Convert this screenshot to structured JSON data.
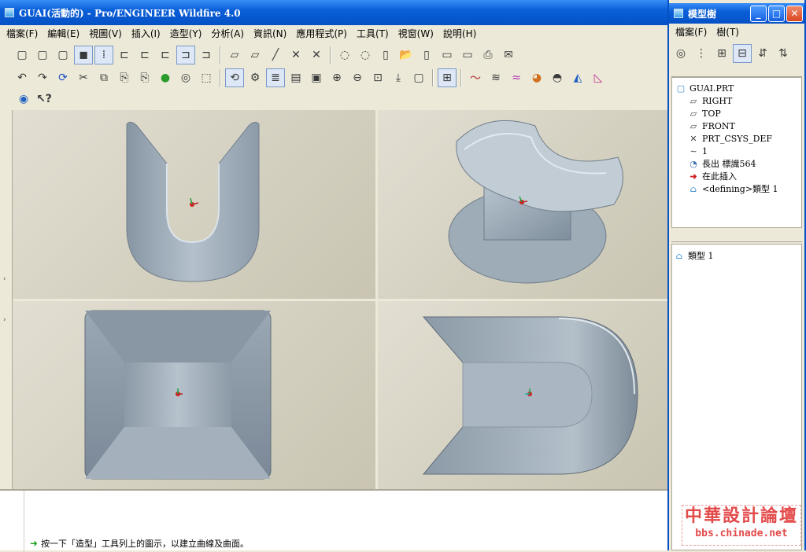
{
  "main_window": {
    "title": "GUAI(活動的) - Pro/ENGINEER Wildfire 4.0",
    "menus": [
      "檔案(F)",
      "編輯(E)",
      "視圖(V)",
      "插入(I)",
      "造型(Y)",
      "分析(A)",
      "資訊(N)",
      "應用程式(P)",
      "工具(T)",
      "視窗(W)",
      "說明(H)"
    ],
    "status_message": "按一下「造型」工具列上的圖示，以建立曲線及曲面。"
  },
  "model_tree": {
    "title": "模型樹",
    "menus": [
      "檔案(F)",
      "樹(T)"
    ],
    "items": [
      {
        "label": "GUAI.PRT",
        "icon": "part-icon"
      },
      {
        "label": "RIGHT",
        "icon": "datum-plane-icon"
      },
      {
        "label": "TOP",
        "icon": "datum-plane-icon"
      },
      {
        "label": "FRONT",
        "icon": "datum-plane-icon"
      },
      {
        "label": "PRT_CSYS_DEF",
        "icon": "csys-icon"
      },
      {
        "label": "1",
        "icon": "curve-icon"
      },
      {
        "label": "長出 標識564",
        "icon": "protrusion-icon"
      },
      {
        "label": "在此插入",
        "icon": "insert-here-arrow-icon"
      },
      {
        "label": "<defining>類型 1",
        "icon": "style-feature-icon"
      }
    ],
    "lower_items": [
      {
        "label": "類型 1",
        "icon": "style-feature-icon"
      }
    ]
  },
  "watermark": {
    "title": "中華設計論壇",
    "url": "bbs.chinade.net"
  },
  "colors": {
    "titlebar": "#0a5fd8",
    "viewport_bg": "#d6d2c2",
    "model_surface": "#a9b7c4",
    "watermark_red": "#e34a4a"
  }
}
